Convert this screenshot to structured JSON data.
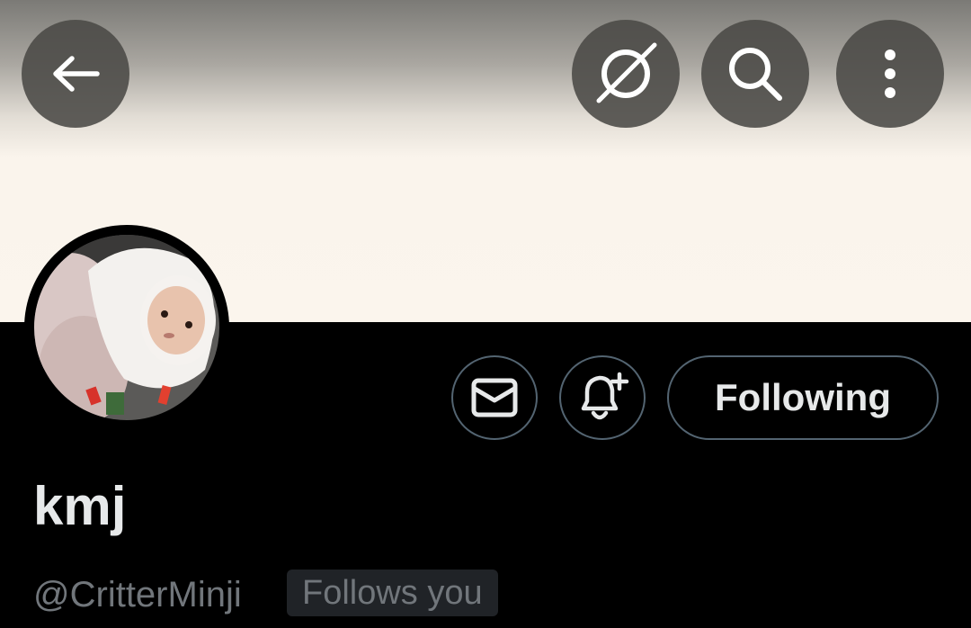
{
  "header": {
    "back_icon": "arrow-left-icon",
    "grok_icon": "grok-slash-circle-icon",
    "search_icon": "search-icon",
    "more_icon": "more-vertical-icon"
  },
  "profile": {
    "display_name": "kmj",
    "handle": "@CritterMinji",
    "follows_you_label": "Follows you",
    "avatar_description_icon": "avatar-photo"
  },
  "actions": {
    "message_icon": "envelope-icon",
    "notify_icon": "bell-plus-icon",
    "following_label": "Following"
  },
  "colors": {
    "background": "#000000",
    "text_primary": "#e7e9ea",
    "text_secondary": "#71767b",
    "button_border": "#536471",
    "badge_bg": "#202327",
    "banner": "#fbf5ed"
  }
}
